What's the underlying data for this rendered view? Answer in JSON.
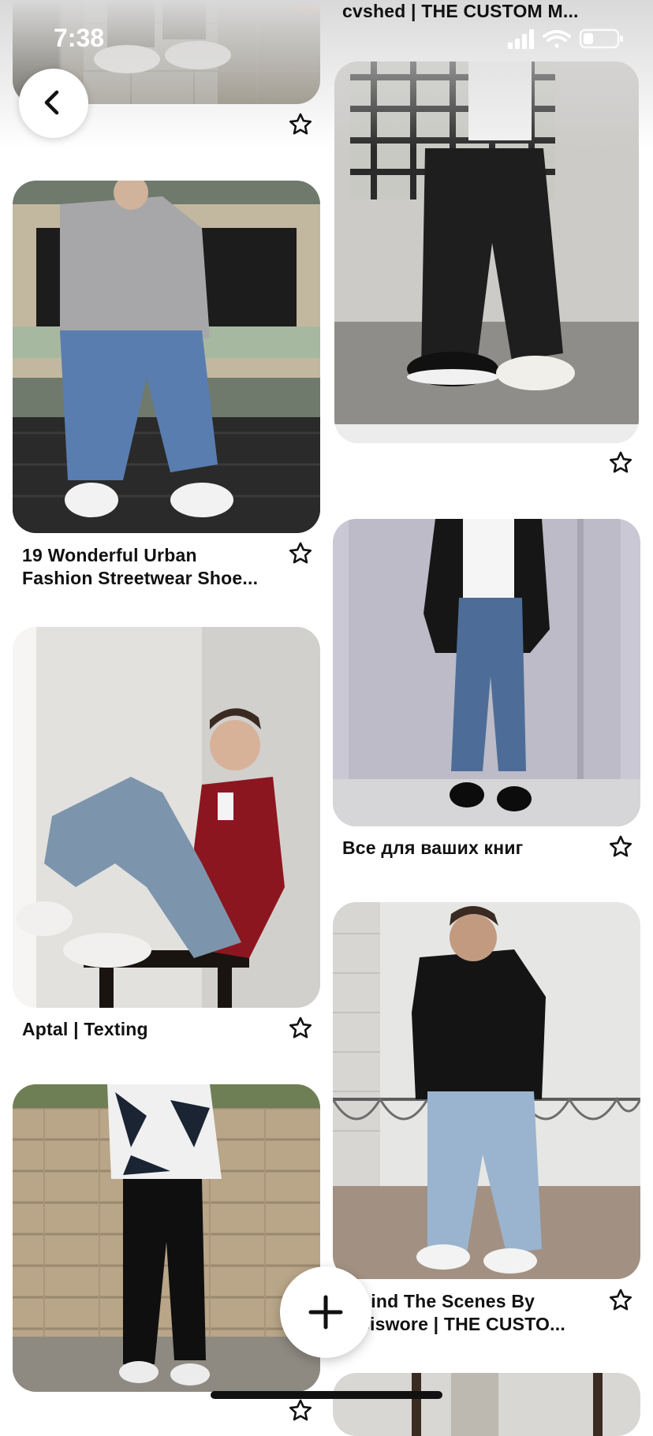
{
  "status_bar": {
    "time": "7:38"
  },
  "header": {
    "partial_title": "cvshed | THE CUSTOM M..."
  },
  "pins": [
    {
      "caption": "",
      "image": "sneakers-on-tiled-floor"
    },
    {
      "caption": "",
      "image": "plaid-shirt-black-pants-converse"
    },
    {
      "caption": "19 Wonderful Urban Fashion Streetwear Shoe...",
      "caption_line1": "19 Wonderful Urban",
      "caption_line2": "Fashion Streetwear Shoe...",
      "image": "grey-sweatshirt-jeans-on-bench"
    },
    {
      "caption": "Все для ваших книг",
      "image": "black-blazer-cuffed-jeans"
    },
    {
      "caption": "Aptal | Texting",
      "image": "red-shirt-seated-in-corner"
    },
    {
      "caption_line1": "hind The Scenes By",
      "caption_line2": "siswore | THE CUSTO...",
      "image": "black-hoodie-light-jeans"
    },
    {
      "caption": "",
      "image": "patterned-shirt-brick-wall"
    },
    {
      "caption": "",
      "image": "partially-visible-pin"
    }
  ],
  "icons": {
    "back": "chevron-left-icon",
    "save": "star-outline-icon",
    "add": "plus-icon",
    "signal": "cellular-signal-icon",
    "wifi": "wifi-icon",
    "battery": "battery-icon"
  }
}
